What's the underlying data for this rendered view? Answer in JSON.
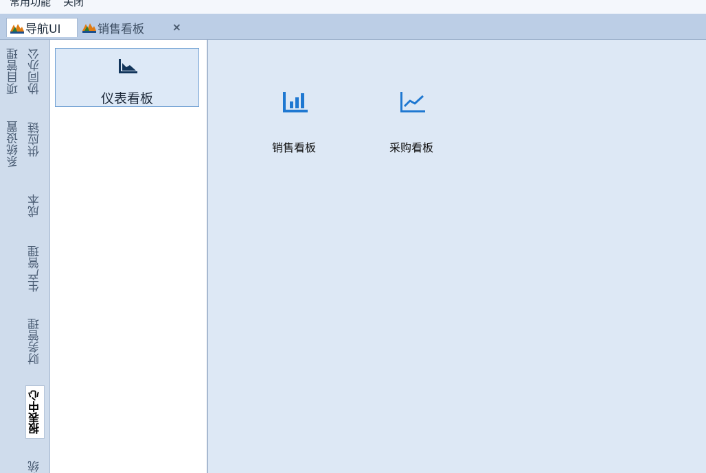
{
  "menubar": {
    "items": [
      "常用功能",
      "关闭"
    ]
  },
  "tabs": [
    {
      "label": "导航UI",
      "icon": "mountain-logo-icon",
      "active": true
    },
    {
      "label": "销售看板",
      "icon": "mountain-logo-icon",
      "active": false,
      "closable": true
    }
  ],
  "rail": {
    "items": [
      "项目管理",
      "协同办公",
      "系统设置",
      "供应链",
      "成本",
      "生产管理",
      "财务管理",
      "报表中心",
      "系统"
    ],
    "active": "报表中心"
  },
  "panel": {
    "modules": [
      {
        "label": "仪表看板",
        "icon": "area-chart-icon",
        "selected": true
      }
    ]
  },
  "content": {
    "tiles": [
      {
        "label": "销售看板",
        "icon": "bar-chart-icon"
      },
      {
        "label": "采购看板",
        "icon": "line-chart-icon"
      }
    ]
  },
  "colors": {
    "accent": "#1f78d1",
    "dark_icon": "#12355b",
    "selected_bg": "#dde9f7"
  }
}
